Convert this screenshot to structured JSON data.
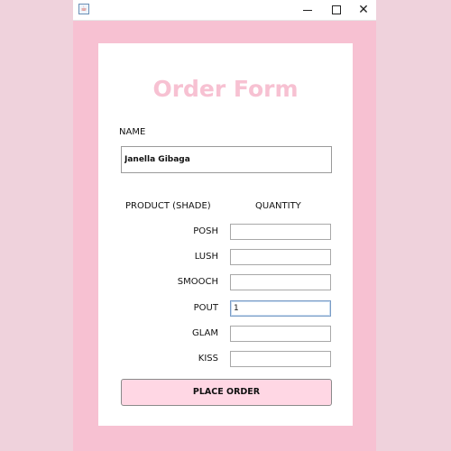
{
  "window": {
    "title_icon": "java-cup-icon",
    "controls": {
      "minimize": "minimize-icon",
      "maximize": "maximize-icon",
      "close": "close-icon"
    }
  },
  "form": {
    "title": "Order Form",
    "name_label": "NAME",
    "name_value": "Janella Gibaga",
    "product_header": "PRODUCT (SHADE)",
    "quantity_header": "QUANTITY",
    "products": [
      {
        "label": "POSH",
        "quantity": ""
      },
      {
        "label": "LUSH",
        "quantity": ""
      },
      {
        "label": "SMOOCH",
        "quantity": ""
      },
      {
        "label": "POUT",
        "quantity": "1"
      },
      {
        "label": "GLAM",
        "quantity": ""
      },
      {
        "label": "KISS",
        "quantity": ""
      }
    ],
    "place_order_label": "PLACE ORDER"
  },
  "colors": {
    "frame_background": "#f7c1d2",
    "title_color": "#f7c1d2",
    "button_background": "#ffd7e4"
  }
}
